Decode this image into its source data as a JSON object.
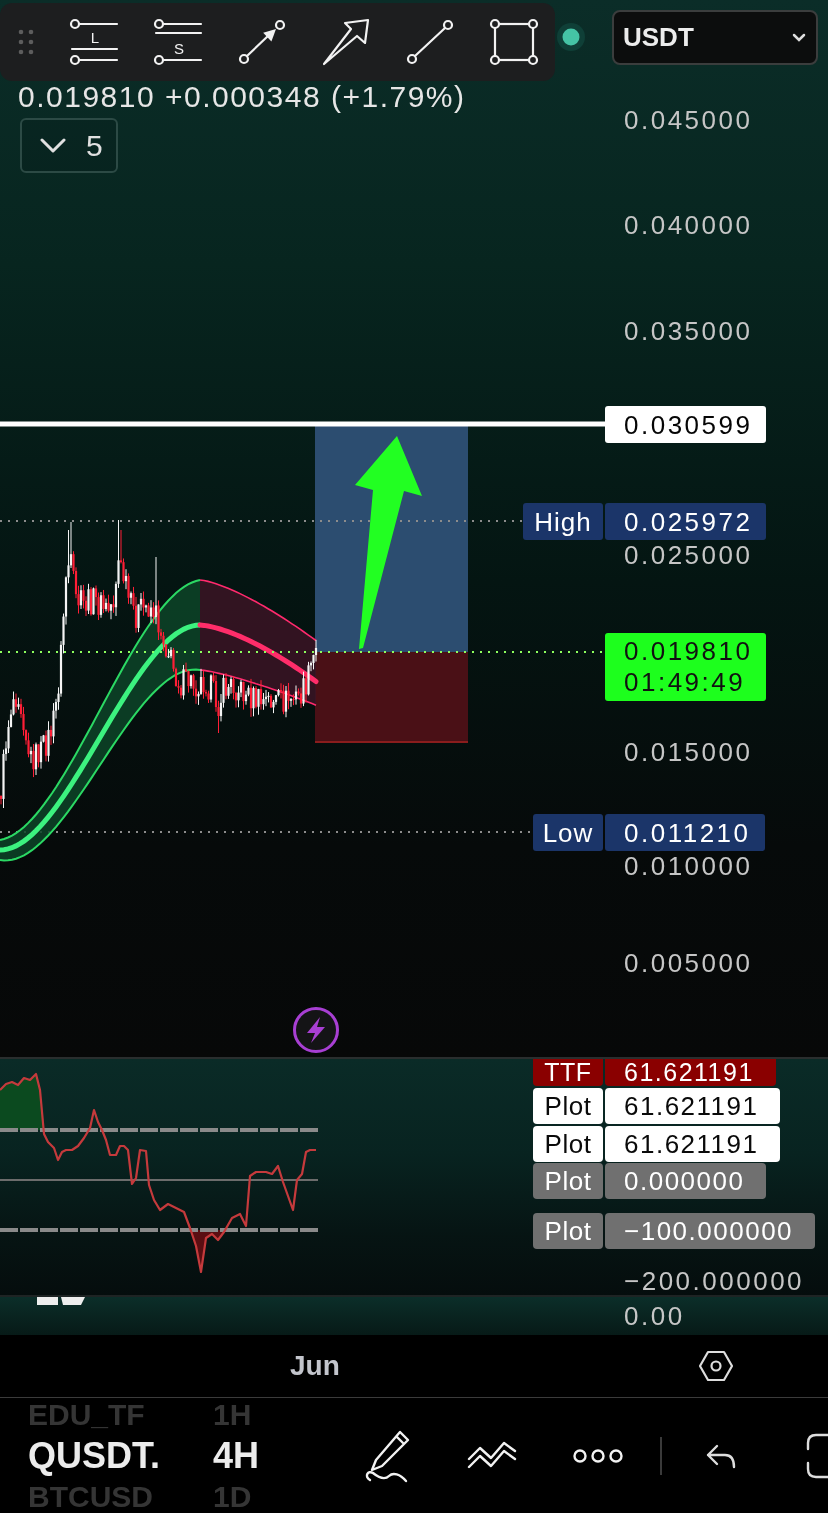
{
  "drawing_toolbar": {
    "tools": [
      {
        "kind": "long-position",
        "label": "L"
      },
      {
        "kind": "short-position",
        "label": "S"
      },
      {
        "kind": "arrow-marker"
      },
      {
        "kind": "arrow"
      },
      {
        "kind": "trend-line"
      },
      {
        "kind": "rectangle"
      }
    ]
  },
  "currency_dropdown": {
    "value": "USDT"
  },
  "legend": {
    "price_change": "0.019810 +0.000348 (+1.79%)",
    "indicators_toggle": {
      "count": "5",
      "expanded": false
    }
  },
  "price_axis": {
    "ticks": [
      "0.045000",
      "0.040000",
      "0.035000",
      "0.025000",
      "0.015000",
      "0.010000",
      "0.005000"
    ]
  },
  "price_tags": [
    {
      "kind": "target",
      "value": "0.030599"
    },
    {
      "kind": "high",
      "label": "High",
      "value": "0.025972"
    },
    {
      "kind": "last",
      "value": "0.019810",
      "countdown": "01:49:49"
    },
    {
      "kind": "low",
      "label": "Low",
      "value": "0.011210"
    }
  ],
  "oscillator_panel": {
    "tags": [
      {
        "label": "TTF",
        "value": "61.621191",
        "color": "#8a0000"
      },
      {
        "label": "Plot",
        "value": "61.621191",
        "color": "#ffffff"
      },
      {
        "label": "Plot",
        "value": "61.621191",
        "color": "#ffffff"
      },
      {
        "label": "Plot",
        "value": "0.000000",
        "color": "#707070"
      },
      {
        "label": "Plot",
        "value": "−100.000000",
        "color": "#707070"
      }
    ],
    "axis_ticks": [
      "−200.000000"
    ]
  },
  "lower_pane": {
    "axis_ticks": [
      "0.00"
    ]
  },
  "time_axis": {
    "labels": [
      "Jun"
    ]
  },
  "symbol_picker": {
    "rows": [
      {
        "symbol": "EDU_TF",
        "interval": "1H",
        "selected": false
      },
      {
        "symbol": "QUSDT.",
        "interval": "4H",
        "selected": true
      },
      {
        "symbol": "BTCUSD",
        "interval": "1D",
        "selected": false
      }
    ]
  }
}
